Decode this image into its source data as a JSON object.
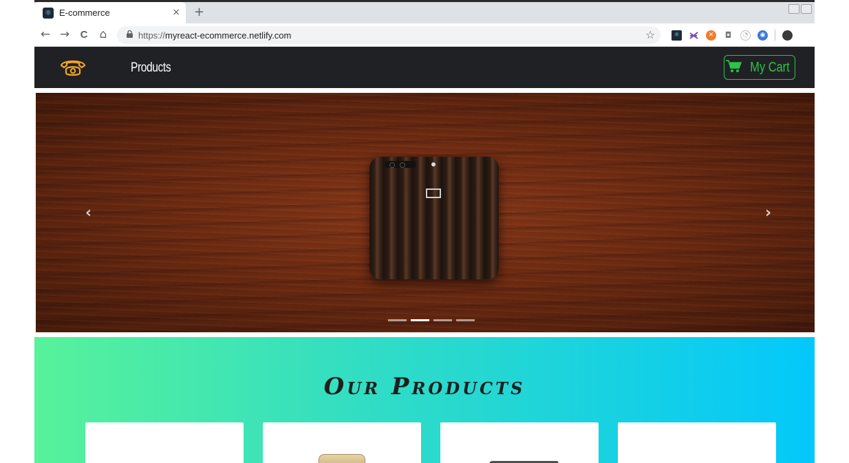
{
  "browser": {
    "tab_title": "E-commerce",
    "tab_close": "×",
    "new_tab": "+",
    "back": "←",
    "forward": "→",
    "reload": "C",
    "home": "⌂",
    "lock": "🔒",
    "url_protocol": "https://",
    "url_host": "myreact-ecommerce.netlify.com",
    "bookmark": "☆",
    "extensions": [
      "react-devtools-icon",
      "redux-devtools-icon",
      "extension-orange-icon",
      "camera-icon",
      "extension-clock-icon",
      "extension-blue-icon"
    ]
  },
  "navbar": {
    "products_label": "Products",
    "cart_label": "My Cart",
    "brand_color": "#f5a623",
    "cart_color": "#2ec34a"
  },
  "carousel": {
    "prev": "‹",
    "next": "›",
    "slide_count": 4,
    "active_slide": 1
  },
  "products": {
    "title": "Our Products",
    "card_count": 4
  }
}
